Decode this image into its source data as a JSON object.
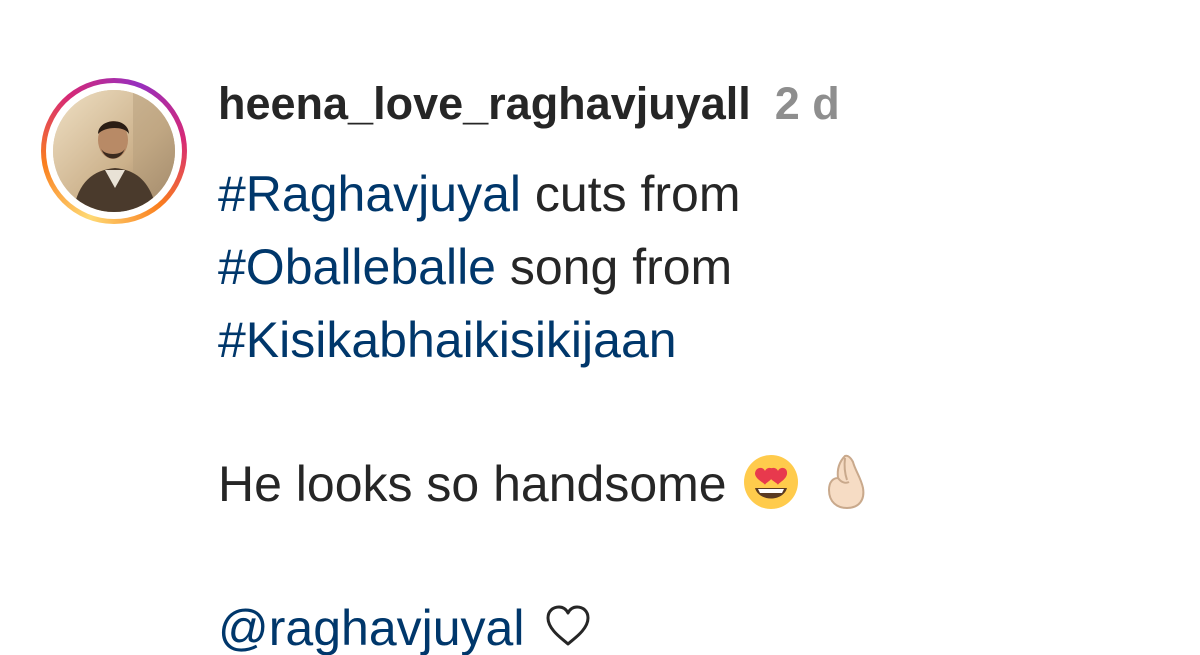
{
  "comment": {
    "username": "heena_love_raghavjuyall",
    "time_ago": "2 d",
    "line1": {
      "tag": "#Raghavjuyal",
      "text": " cuts from"
    },
    "line2": {
      "tag": "#Oballeballe",
      "text": " song from"
    },
    "line3": {
      "tag": "#Kisikabhaikisikijaan"
    },
    "line4": {
      "text": "He looks so handsome "
    },
    "line5": {
      "mention": "@raghavjuyal",
      "text": " "
    },
    "icons": [
      "heart-eyes-emoji",
      "pinched-fingers-emoji",
      "heart-outline-icon"
    ],
    "colors": {
      "hashtag": "#00376b",
      "text": "#262626",
      "time": "#8e8e8e"
    }
  }
}
